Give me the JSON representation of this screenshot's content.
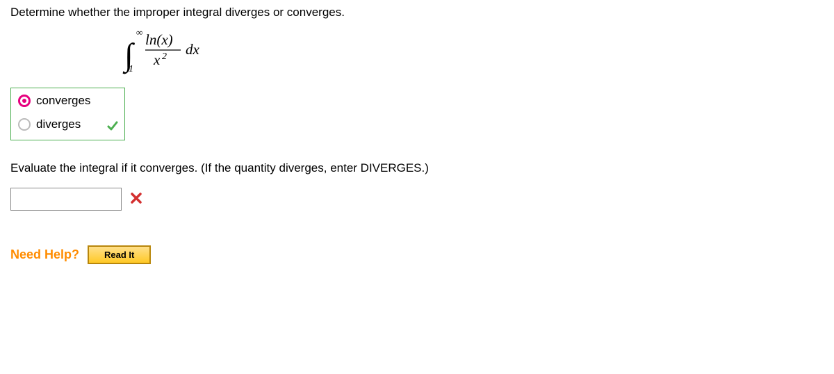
{
  "question": {
    "prompt": "Determine whether the improper integral diverges or converges.",
    "integral": {
      "lower": "1",
      "upper": "∞",
      "numerator": "ln(x)",
      "denom_base": "x",
      "denom_exp": "2",
      "dx": "dx"
    },
    "options": {
      "converges": "converges",
      "diverges": "diverges"
    },
    "evaluate_prompt": "Evaluate the integral if it converges. (If the quantity diverges, enter DIVERGES.)",
    "answer_value": ""
  },
  "help": {
    "label": "Need Help?",
    "read_it": "Read It"
  }
}
